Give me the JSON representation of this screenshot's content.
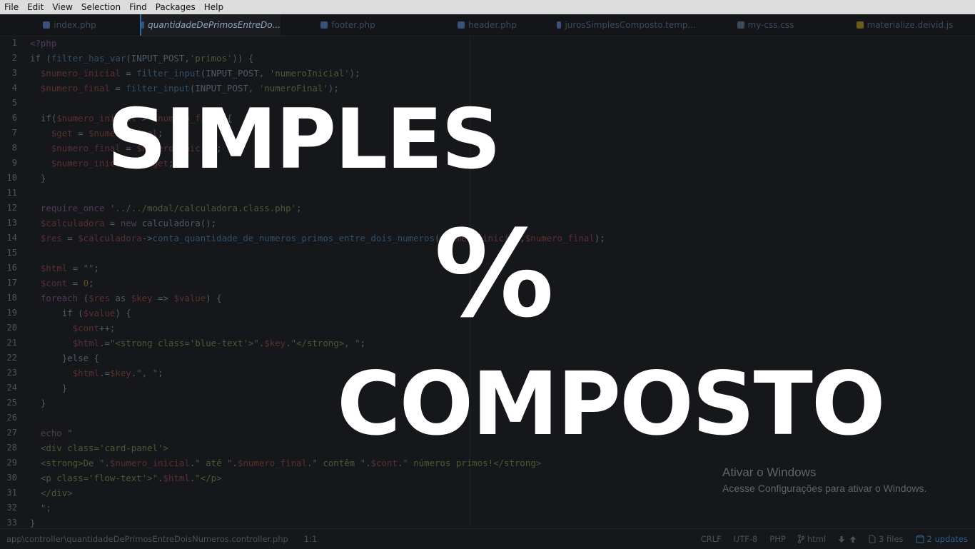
{
  "menu": [
    "File",
    "Edit",
    "View",
    "Selection",
    "Find",
    "Packages",
    "Help"
  ],
  "tabs": [
    {
      "label": "index.php",
      "active": false,
      "icon": "php-file-icon",
      "color": "#3a4f7a"
    },
    {
      "label": "quantidadeDePrimosEntreDo...",
      "active": true,
      "icon": "php-file-icon",
      "color": "#3a4f7a"
    },
    {
      "label": "footer.php",
      "active": false,
      "icon": "php-file-icon",
      "color": "#3a4f7a"
    },
    {
      "label": "header.php",
      "active": false,
      "icon": "php-file-icon",
      "color": "#3a4f7a"
    },
    {
      "label": "jurosSimplesComposto.temp...",
      "active": false,
      "icon": "php-file-icon",
      "color": "#3a4f7a"
    },
    {
      "label": "my-css.css",
      "active": false,
      "icon": "css-file-icon",
      "color": "#3d4b61"
    },
    {
      "label": "materialize.deivid.js",
      "active": false,
      "icon": "js-file-icon",
      "color": "#6b5b1e"
    }
  ],
  "code_lines": [
    [
      [
        "<?php",
        "k"
      ]
    ],
    [
      [
        "if (",
        "t"
      ],
      [
        "filter_has_var",
        "f"
      ],
      [
        "(INPUT_POST,",
        "t"
      ],
      [
        "'primos'",
        "s"
      ],
      [
        ")) {",
        "t"
      ]
    ],
    [
      [
        "  ",
        "t"
      ],
      [
        "$numero_inicial",
        "v"
      ],
      [
        " = ",
        "t"
      ],
      [
        "filter_input",
        "f"
      ],
      [
        "(INPUT_POST, ",
        "t"
      ],
      [
        "'numeroInicial'",
        "s"
      ],
      [
        ");",
        "t"
      ]
    ],
    [
      [
        "  ",
        "t"
      ],
      [
        "$numero_final",
        "v"
      ],
      [
        " = ",
        "t"
      ],
      [
        "filter_input",
        "f"
      ],
      [
        "(INPUT_POST, ",
        "t"
      ],
      [
        "'numeroFinal'",
        "s"
      ],
      [
        ");",
        "t"
      ]
    ],
    [],
    [
      [
        "  if(",
        "t"
      ],
      [
        "$numero_inicial",
        "v"
      ],
      [
        " > ",
        "t"
      ],
      [
        "$numero_final",
        "v"
      ],
      [
        "){",
        "t"
      ]
    ],
    [
      [
        "    ",
        "t"
      ],
      [
        "$get",
        "v"
      ],
      [
        " = ",
        "t"
      ],
      [
        "$numero_final",
        "v"
      ],
      [
        ";",
        "t"
      ]
    ],
    [
      [
        "    ",
        "t"
      ],
      [
        "$numero_final",
        "v"
      ],
      [
        " = ",
        "t"
      ],
      [
        "$numero_inicial",
        "v"
      ],
      [
        ";",
        "t"
      ]
    ],
    [
      [
        "    ",
        "t"
      ],
      [
        "$numero_inicial",
        "v"
      ],
      [
        " = ",
        "t"
      ],
      [
        "$get",
        "v"
      ],
      [
        ";",
        "t"
      ]
    ],
    [
      [
        "  }",
        "t"
      ]
    ],
    [],
    [
      [
        "  ",
        "t"
      ],
      [
        "require_once",
        "k"
      ],
      [
        " ",
        "t"
      ],
      [
        "'../../modal/calculadora.class.php'",
        "s"
      ],
      [
        ";",
        "t"
      ]
    ],
    [
      [
        "  ",
        "t"
      ],
      [
        "$calculadora",
        "v"
      ],
      [
        " = ",
        "t"
      ],
      [
        "new",
        "k"
      ],
      [
        " calculadora();",
        "t"
      ]
    ],
    [
      [
        "  ",
        "t"
      ],
      [
        "$res",
        "v"
      ],
      [
        " = ",
        "t"
      ],
      [
        "$calculadora",
        "v"
      ],
      [
        "->",
        "t"
      ],
      [
        "conta_quantidade_de_numeros_primos_entre_dois_numeros",
        "f"
      ],
      [
        "(",
        "t"
      ],
      [
        "$numero_inicial",
        "v"
      ],
      [
        ",",
        "t"
      ],
      [
        "$numero_final",
        "v"
      ],
      [
        ");",
        "t"
      ]
    ],
    [],
    [
      [
        "  ",
        "t"
      ],
      [
        "$html",
        "v"
      ],
      [
        " = ",
        "t"
      ],
      [
        "\"\"",
        "s"
      ],
      [
        ";",
        "t"
      ]
    ],
    [
      [
        "  ",
        "t"
      ],
      [
        "$cont",
        "v"
      ],
      [
        " = ",
        "t"
      ],
      [
        "0",
        "c"
      ],
      [
        ";",
        "t"
      ]
    ],
    [
      [
        "  ",
        "t"
      ],
      [
        "foreach",
        "k"
      ],
      [
        " (",
        "t"
      ],
      [
        "$res",
        "v"
      ],
      [
        " as ",
        "t"
      ],
      [
        "$key",
        "v"
      ],
      [
        " => ",
        "t"
      ],
      [
        "$value",
        "v"
      ],
      [
        ") {",
        "t"
      ]
    ],
    [
      [
        "      if (",
        "t"
      ],
      [
        "$value",
        "v"
      ],
      [
        ") {",
        "t"
      ]
    ],
    [
      [
        "        ",
        "t"
      ],
      [
        "$cont",
        "v"
      ],
      [
        "++;",
        "t"
      ]
    ],
    [
      [
        "        ",
        "t"
      ],
      [
        "$html",
        "v"
      ],
      [
        ".=",
        "t"
      ],
      [
        "\"<strong class='blue-text'>\"",
        "s"
      ],
      [
        ".",
        "t"
      ],
      [
        "$key",
        "v"
      ],
      [
        ".",
        "t"
      ],
      [
        "\"</strong>, \"",
        "s"
      ],
      [
        ";",
        "t"
      ]
    ],
    [
      [
        "      }else {",
        "t"
      ]
    ],
    [
      [
        "        ",
        "t"
      ],
      [
        "$html",
        "v"
      ],
      [
        ".=",
        "t"
      ],
      [
        "$key",
        "v"
      ],
      [
        ".",
        "t"
      ],
      [
        "\", \"",
        "s"
      ],
      [
        ";",
        "t"
      ]
    ],
    [
      [
        "      }",
        "t"
      ]
    ],
    [
      [
        "  }",
        "t"
      ]
    ],
    [],
    [
      [
        "  echo ",
        "k"
      ],
      [
        "\"",
        "s"
      ]
    ],
    [
      [
        "  ",
        "t"
      ],
      [
        "<div class='card-panel'>",
        "s"
      ]
    ],
    [
      [
        "  ",
        "t"
      ],
      [
        "<strong>De \"",
        "s"
      ],
      [
        ".",
        "t"
      ],
      [
        "$numero_inicial",
        "v"
      ],
      [
        ".",
        "t"
      ],
      [
        "\" até \"",
        "s"
      ],
      [
        ".",
        "t"
      ],
      [
        "$numero_final",
        "v"
      ],
      [
        ".",
        "t"
      ],
      [
        "\" contêm \"",
        "s"
      ],
      [
        ".",
        "t"
      ],
      [
        "$cont",
        "v"
      ],
      [
        ".",
        "t"
      ],
      [
        "\" números primos!</strong>",
        "s"
      ]
    ],
    [
      [
        "  ",
        "t"
      ],
      [
        "<p class='flow-text'>\"",
        "s"
      ],
      [
        ".",
        "t"
      ],
      [
        "$html",
        "v"
      ],
      [
        ".",
        "t"
      ],
      [
        "\"</p>",
        "s"
      ]
    ],
    [
      [
        "  ",
        "t"
      ],
      [
        "</div>",
        "s"
      ]
    ],
    [
      [
        "  ",
        "t"
      ],
      [
        "\";",
        "s"
      ]
    ],
    [
      [
        "}",
        "t"
      ]
    ]
  ],
  "overlay": {
    "line1": "SIMPLES",
    "line2": "%",
    "line3": "COMPOSTO"
  },
  "windows_activation": {
    "title": "Ativar o Windows",
    "subtitle": "Acesse Configurações para ativar o Windows."
  },
  "status": {
    "path": "app\\controller\\quantidadeDePrimosEntreDoisNumeros.controller.php",
    "cursor": "1:1",
    "line_ending": "CRLF",
    "encoding": "UTF-8",
    "grammar": "PHP",
    "branch": "html",
    "files": "3 files",
    "updates": "2 updates"
  }
}
